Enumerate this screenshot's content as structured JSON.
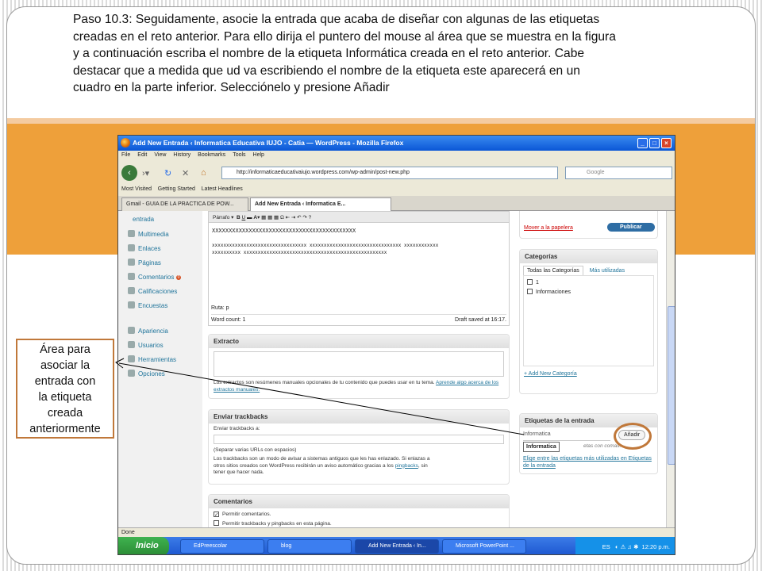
{
  "instruction": {
    "lines": [
      "Paso 10.3: Seguidamente, asocie la entrada que acaba de diseñar con  algunas de las etiquetas",
      "creadas en el reto anterior. Para ello dirija el puntero del mouse al área que se muestra en la figura",
      "y a continuación escriba el nombre de la etiqueta Informática creada en el reto anterior. Cabe",
      "destacar que a medida que ud va escribiendo el nombre de la etiqueta este aparecerá en un",
      "cuadro en la parte inferior.  Selecciónelo y presione Añadir"
    ]
  },
  "callout": {
    "lines": [
      "Área para",
      "asociar la",
      "entrada con",
      "la  etiqueta",
      "creada",
      "anteriormente"
    ]
  },
  "browser": {
    "title": "Add New Entrada ‹ Informatica Educativa IUJO - Catia — WordPress - Mozilla Firefox",
    "menu": [
      "File",
      "Edit",
      "View",
      "History",
      "Bookmarks",
      "Tools",
      "Help"
    ],
    "url": "http://informaticaeducativaiujo.wordpress.com/wp-admin/post-new.php",
    "search_placeholder": "Google",
    "bookmarks": [
      "Most Visited",
      "Getting Started",
      "Latest Headlines"
    ],
    "tabs": [
      "Gmail - GUIA DE LA PRACTICA DE POW...",
      "Add New Entrada ‹ Informatica E..."
    ],
    "status": "Done"
  },
  "wp": {
    "sidebar": [
      "entrada",
      "Multimedia",
      "Enlaces",
      "Páginas",
      "Comentarios",
      "Calificaciones",
      "Encuestas",
      "Apariencia",
      "Usuarios",
      "Herramientas",
      "Opciones"
    ],
    "comment_badge": "0",
    "editor": {
      "format": "Párrafo",
      "line1": "XXXXXXXXXXXXXXXXXXXXXXXXXXXXXXXXXXXXXXXXXXX",
      "line2": "xxxxxxxxxxxxxxxxxxxxxxxxxxxxxxxxx xxxxxxxxxxxxxxxxxxxxxxxxxxxxxxxx xxxxxxxxxxxx",
      "line3": "xxxxxxxxxx xxxxxxxxxxxxxxxxxxxxxxxxxxxxxxxxxxxxxxxxxxxxxxxxxx",
      "path": "Ruta: p",
      "word_count": "Word count: 1",
      "draft_saved": "Draft saved at 16:17."
    },
    "excerpt": {
      "title": "Extracto",
      "help": "Los extractos son resúmenes manuales opcionales de tu contenido que puedes usar en tu tema.",
      "link": "Aprende algo acerca de los extractos manuales."
    },
    "trackbacks": {
      "title": "Enviar trackbacks",
      "label": "Enviar trackbacks a:",
      "hint": "(Separar varias URLs con espacios)",
      "help1": "Los trackbacks son un modo de avisar a sistemas antiguos que les has enlazado. Si enlazas a",
      "help2": "otros sitios creados con WordPress recibirán un aviso automático gracias a los",
      "link": "pingbacks",
      "help3": ", sin",
      "help4": "tener que hacer nada."
    },
    "comments": {
      "title": "Comentarios",
      "opt1": "Permitir comentarios.",
      "opt2": "Permitir trackbacks y pingbacks en esta página."
    },
    "publish": {
      "trash": "Mover a la papelera",
      "button": "Publicar"
    },
    "categories": {
      "title": "Categorías",
      "tab_all": "Todas las Categorías",
      "tab_used": "Más utilizadas",
      "items": [
        "1",
        "Informaciones"
      ],
      "add": "+ Add New Categoría"
    },
    "tags": {
      "title": "Etiquetas de la entrada",
      "input": "Informatica",
      "add": "Añadir",
      "hint": "etas con comas.",
      "suggestion": "Informatica",
      "more": "Elige entre las etiquetas más utilizadas en Etiquetas de la entrada"
    }
  },
  "taskbar": {
    "start": "Inicio",
    "items": [
      "EdPreescolar",
      "blog",
      "Add New Entrada ‹ In...",
      "Microsoft PowerPoint ..."
    ],
    "lang": "ES",
    "time": "12:20 p.m."
  }
}
